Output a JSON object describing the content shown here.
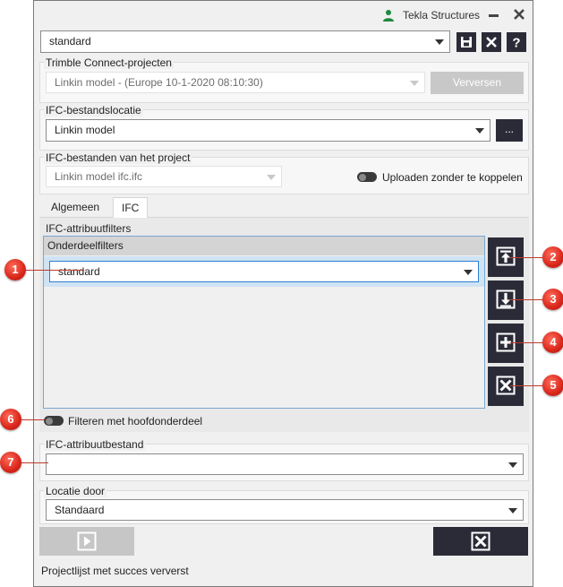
{
  "window": {
    "app_title": "Tekla Structures"
  },
  "settings": {
    "selected": "standard"
  },
  "trimble": {
    "group_label": "Trimble Connect-projecten",
    "project": "Linkin model - (Europe 10-1-2020 08:10:30)",
    "refresh_label": "Verversen"
  },
  "location": {
    "group_label": "IFC-bestandslocatie",
    "value": "Linkin model",
    "browse_label": "..."
  },
  "project_files": {
    "group_label": "IFC-bestanden van het project",
    "value": "Linkin model ifc.ifc",
    "upload_toggle_label": "Uploaden zonder te koppelen"
  },
  "tabs": [
    {
      "label": "Algemeen",
      "active": false
    },
    {
      "label": "IFC",
      "active": true
    }
  ],
  "filters": {
    "group_label": "IFC-attribuutfilters",
    "list_header": "Onderdeelfilters",
    "rows": [
      "standard"
    ],
    "main_part_toggle_label": "Filteren met hoofdonderdeel"
  },
  "attr_file": {
    "group_label": "IFC-attribuutbestand",
    "value": ""
  },
  "location_by": {
    "group_label": "Locatie door",
    "value": "Standaard"
  },
  "status": {
    "message": "Projectlijst met succes ververst"
  },
  "callouts": [
    "1",
    "2",
    "3",
    "4",
    "5",
    "6",
    "7"
  ],
  "colors": {
    "dark_button": "#2b2b38",
    "callout": "#d9261a",
    "accent_blue": "#0078d7"
  },
  "icons": [
    "user-icon",
    "minimize-icon",
    "close-icon",
    "save-icon",
    "delete-icon",
    "help-icon",
    "move-top-icon",
    "move-down-icon",
    "add-icon",
    "remove-icon",
    "play-icon",
    "cancel-icon"
  ]
}
